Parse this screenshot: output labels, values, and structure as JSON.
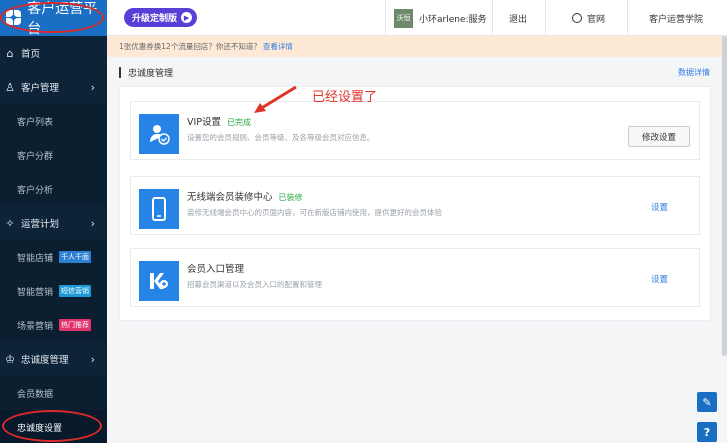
{
  "app": {
    "title": "客户运营平台"
  },
  "sidebar": {
    "items": [
      {
        "type": "item",
        "label": "首页",
        "icon": "home-icon",
        "glyph": "⌂"
      },
      {
        "type": "item",
        "label": "客户管理",
        "icon": "users-icon",
        "glyph": "♙",
        "chevron": "›"
      },
      {
        "type": "sub",
        "label": "客户列表"
      },
      {
        "type": "sub",
        "label": "客户分群"
      },
      {
        "type": "sub",
        "label": "客户分析"
      },
      {
        "type": "item",
        "label": "运营计划",
        "icon": "bulb-icon",
        "glyph": "✧",
        "chevron": "›"
      },
      {
        "type": "sub",
        "label": "智能店铺",
        "tag": "千人千面",
        "tag_color": "blue"
      },
      {
        "type": "sub",
        "label": "智能营销",
        "tag": "短信营销",
        "tag_color": "cyan"
      },
      {
        "type": "sub",
        "label": "场景营销",
        "tag": "热门推荐",
        "tag_color": "pink"
      },
      {
        "type": "item",
        "label": "忠诚度管理",
        "icon": "crown-icon",
        "glyph": "♔",
        "chevron": "›"
      },
      {
        "type": "sub",
        "label": "会员数据"
      },
      {
        "type": "sub",
        "label": "忠诚度设置",
        "active": true
      }
    ]
  },
  "topbar": {
    "upgrade_label": "升级定制版",
    "avatar_text": "沃恒",
    "user_label": "小环arlene:服务",
    "logout_label": "退出",
    "official_label": "官网",
    "academy_label": "客户运营学院"
  },
  "notice": {
    "text": "1张优惠券换12个流量回店？你还不知道？",
    "link": "查看详情"
  },
  "page": {
    "title": "忠诚度管理",
    "right_link": "数据详情"
  },
  "cards": [
    {
      "title": "VIP设置",
      "status": "已完成",
      "desc": "设置您的会员规则、会员等级、及各等级会员对应信息。",
      "action": "修改设置",
      "action_type": "button",
      "icon": "vip-user-icon"
    },
    {
      "title": "无线端会员装修中心",
      "status": "已装修",
      "desc": "装修无线端会员中心的页面内容，可在新版店铺内使用，提供更好的会员体验",
      "action": "设置",
      "action_type": "link",
      "icon": "mobile-phone-icon"
    },
    {
      "title": "会员入口管理",
      "status": "",
      "desc": "招募会员渠道以及会员入口的配置和管理",
      "action": "设置",
      "action_type": "link",
      "icon": "member-entry-icon"
    }
  ],
  "annotation": {
    "text": "已经设置了"
  },
  "colors": {
    "primary": "#1a6fc4",
    "sidebar": "#0d2438",
    "success": "#27a844",
    "link": "#2d7be0",
    "annotation": "#e0332a"
  }
}
